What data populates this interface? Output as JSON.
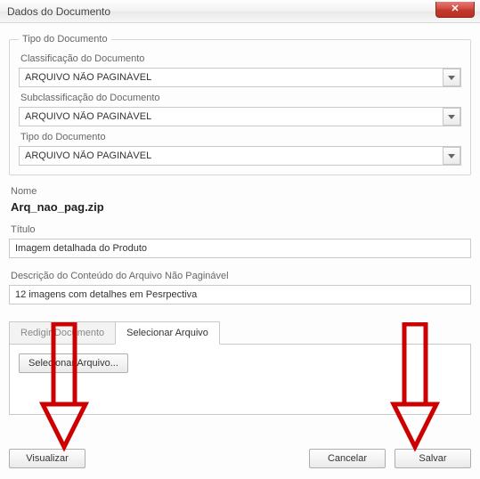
{
  "window": {
    "title": "Dados do Documento"
  },
  "group": {
    "legend": "Tipo do Documento",
    "classificacao_label": "Classificação do Documento",
    "classificacao_value": "ARQUIVO NÃO PAGINÁVEL",
    "subclassificacao_label": "Subclassificação do Documento",
    "subclassificacao_value": "ARQUIVO NÃO PAGINÁVEL",
    "tipo_label": "Tipo do Documento",
    "tipo_value": "ARQUIVO NÃO PAGINÁVEL"
  },
  "nome": {
    "label": "Nome",
    "value": "Arq_nao_pag.zip"
  },
  "titulo": {
    "label": "Título",
    "value": "Imagem detalhada do Produto"
  },
  "descricao": {
    "label": "Descrição do Conteúdo do Arquivo Não Paginável",
    "value": "12 imagens com detalhes em Pesrpectiva"
  },
  "tabs": {
    "redigir": "Redigir Documento",
    "selecionar": "Selecionar Arquivo"
  },
  "buttons": {
    "selecionar_arquivo": "Selecionar Arquivo...",
    "visualizar": "Visualizar",
    "cancelar": "Cancelar",
    "salvar": "Salvar"
  }
}
